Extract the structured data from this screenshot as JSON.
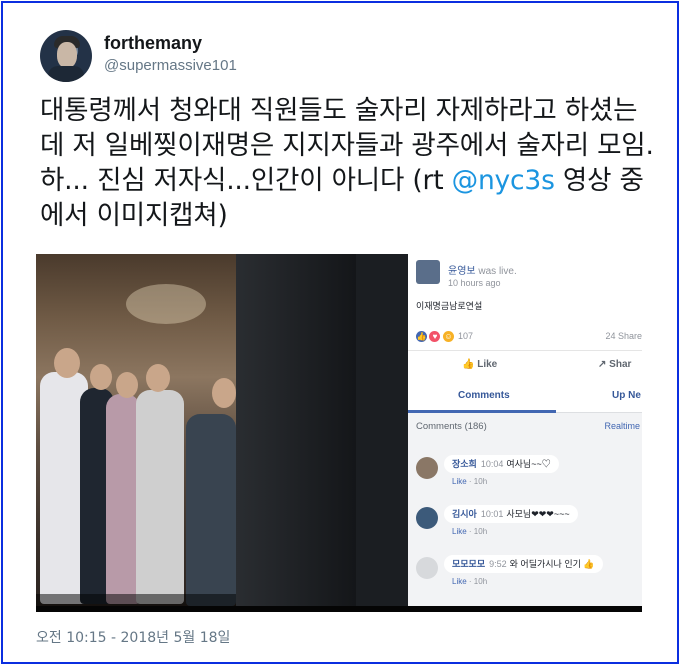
{
  "tweet": {
    "display_name": "forthemany",
    "handle": "@supermassive101",
    "text_part1": "대통령께서 청와대 직원들도 술자리 자제하라고 하셨는데 저 일베찢이재명은 지지자들과 광주에서 술자리 모임. 하... 진심 저자식...인간이 아니다 (rt ",
    "mention": "@nyc3s",
    "text_part2": " 영상 중에서 이미지캡쳐)",
    "timestamp": "오전 10:15 - 2018년 5월 18일"
  },
  "facebook_panel": {
    "poster_name": "윤영보",
    "live_label": "was live.",
    "post_time": "10 hours ago",
    "post_text": "이재명금남로연설",
    "reaction_count": "107",
    "shares": "24 Share",
    "like_label": "Like",
    "share_label": "Shar",
    "tab_comments": "Comments",
    "tab_upnext": "Up Ne",
    "comments_count": "Comments (186)",
    "realtime_label": "Realtime",
    "comments": [
      {
        "name": "장소희",
        "time": "10:04",
        "text": "여사님~~♡",
        "like": "Like",
        "age": "10h"
      },
      {
        "name": "김시아",
        "time": "10:01",
        "text": "사모님❤❤❤~~~",
        "like": "Like",
        "age": "10h"
      },
      {
        "name": "모모모모",
        "time": "9:52",
        "text": "와 어딜가시나 인기 👍",
        "like": "Like",
        "age": "10h"
      }
    ]
  },
  "colors": {
    "frame_border": "#0b2ee0",
    "mention": "#1b95e0",
    "facebook_blue": "#4267b2"
  }
}
